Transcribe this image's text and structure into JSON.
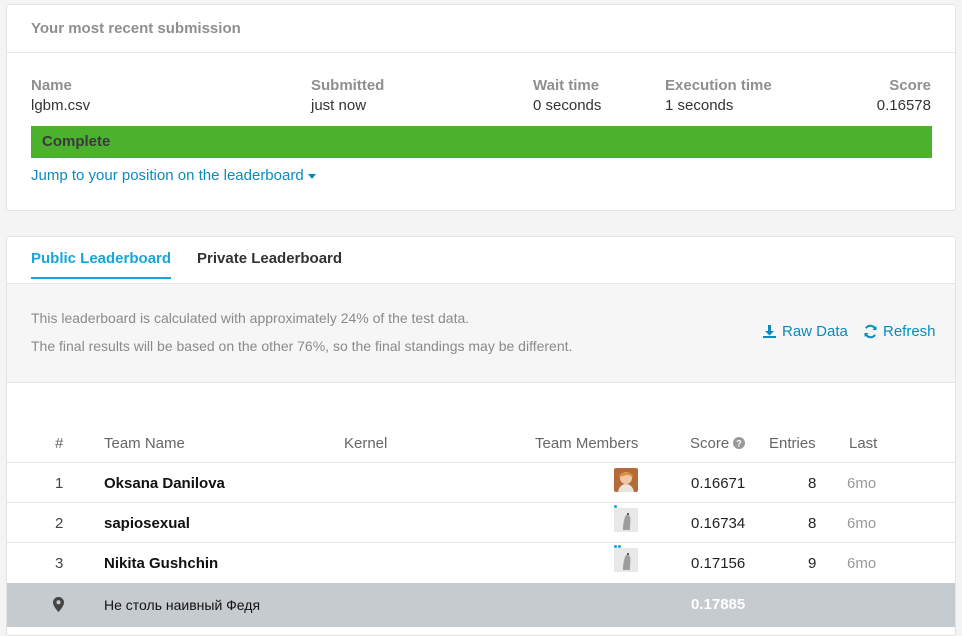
{
  "submission": {
    "heading": "Your most recent submission",
    "columns": [
      {
        "label": "Name",
        "value": "lgbm.csv"
      },
      {
        "label": "Submitted",
        "value": "just now"
      },
      {
        "label": "Wait time",
        "value": "0 seconds"
      },
      {
        "label": "Execution time",
        "value": "1 seconds"
      },
      {
        "label": "Score",
        "value": "0.16578"
      }
    ],
    "status": "Complete",
    "status_color": "#4cb12d",
    "jump_link": "Jump to your position on the leaderboard"
  },
  "leaderboard": {
    "tabs": [
      {
        "label": "Public Leaderboard",
        "active": true
      },
      {
        "label": "Private Leaderboard",
        "active": false
      }
    ],
    "info_line_1": "This leaderboard is calculated with approximately 24% of the test data.",
    "info_line_2": "The final results will be based on the other 76%, so the final standings may be different.",
    "raw_data_label": "Raw Data",
    "refresh_label": "Refresh",
    "headers": {
      "rank": "#",
      "team": "Team Name",
      "kernel": "Kernel",
      "members": "Team Members",
      "score": "Score",
      "entries": "Entries",
      "last": "Last"
    },
    "rows": [
      {
        "rank": "1",
        "team": "Oksana Danilova",
        "score": "0.16671",
        "entries": "8",
        "last": "6mo",
        "avatar": "photo-avatar"
      },
      {
        "rank": "2",
        "team": "sapiosexual",
        "score": "0.16734",
        "entries": "8",
        "last": "6mo",
        "avatar": "goose-avatar"
      },
      {
        "rank": "3",
        "team": "Nikita Gushchin",
        "score": "0.17156",
        "entries": "9",
        "last": "6mo",
        "avatar": "goose-avatar"
      }
    ],
    "your_row": {
      "team": "Не столь наивный Федя",
      "score": "0.17885",
      "icon": "map-pin-icon"
    },
    "accent_color": "#18a5dc",
    "link_color": "#0a8bbf"
  }
}
